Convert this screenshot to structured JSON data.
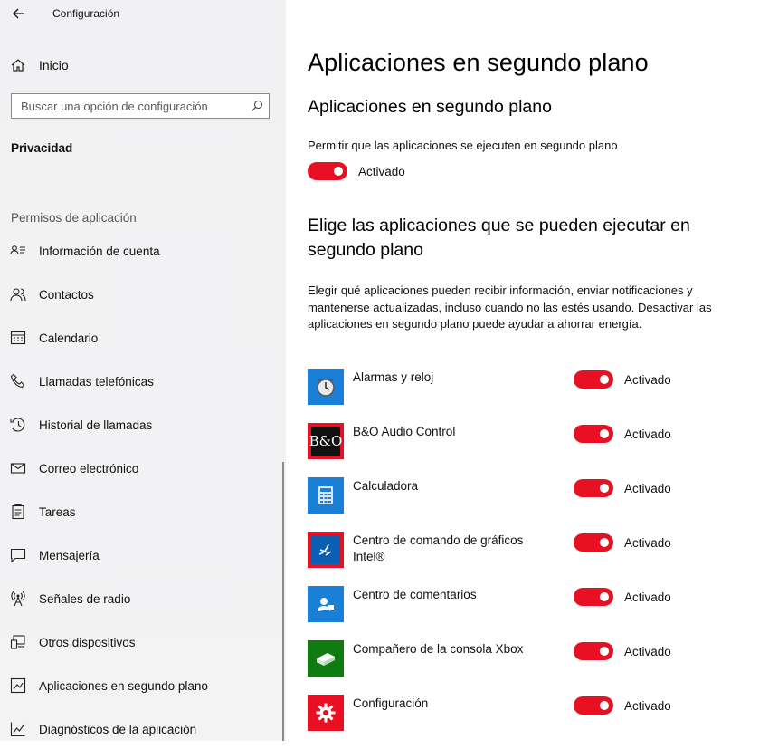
{
  "window": {
    "title": "Configuración"
  },
  "sidebar": {
    "home_label": "Inicio",
    "search_placeholder": "Buscar una opción de configuración",
    "section_label": "Privacidad",
    "group_label": "Permisos de aplicación",
    "items": [
      {
        "label": "Información de cuenta",
        "icon": "account-info-icon"
      },
      {
        "label": "Contactos",
        "icon": "contacts-icon"
      },
      {
        "label": "Calendario",
        "icon": "calendar-icon"
      },
      {
        "label": "Llamadas telefónicas",
        "icon": "phone-icon"
      },
      {
        "label": "Historial de llamadas",
        "icon": "call-history-icon"
      },
      {
        "label": "Correo electrónico",
        "icon": "mail-icon"
      },
      {
        "label": "Tareas",
        "icon": "tasks-icon"
      },
      {
        "label": "Mensajería",
        "icon": "messaging-icon"
      },
      {
        "label": "Señales de radio",
        "icon": "radio-icon"
      },
      {
        "label": "Otros dispositivos",
        "icon": "devices-icon"
      },
      {
        "label": "Aplicaciones en segundo plano",
        "icon": "background-apps-icon"
      },
      {
        "label": "Diagnósticos de la aplicación",
        "icon": "diagnostics-icon"
      }
    ]
  },
  "main": {
    "page_title": "Aplicaciones en segundo plano",
    "section_title": "Aplicaciones en segundo plano",
    "allow_label": "Permitir que las aplicaciones se ejecuten en segundo plano",
    "allow_state": "Activado",
    "choose_title": "Elige las aplicaciones que se pueden ejecutar en segundo plano",
    "description": "Elegir qué aplicaciones pueden recibir información, enviar notificaciones y mantenerse actualizadas, incluso cuando no las estés usando. Desactivar las aplicaciones en segundo plano puede ayudar a ahorrar energía.",
    "apps": [
      {
        "name": "Alarmas y reloj",
        "state": "Activado",
        "icon": "alarm-clock-icon",
        "color": "#1a7fd6"
      },
      {
        "name": "B&O Audio Control",
        "state": "Activado",
        "icon": "bo-audio-icon",
        "color": "#e81123"
      },
      {
        "name": "Calculadora",
        "state": "Activado",
        "icon": "calculator-icon",
        "color": "#1a7fd6"
      },
      {
        "name": "Centro de comando de gráficos Intel®",
        "state": "Activado",
        "icon": "intel-graphics-icon",
        "color": "#e81123"
      },
      {
        "name": "Centro de comentarios",
        "state": "Activado",
        "icon": "feedback-hub-icon",
        "color": "#1a7fd6"
      },
      {
        "name": "Compañero de la consola Xbox",
        "state": "Activado",
        "icon": "xbox-console-icon",
        "color": "#107c10"
      },
      {
        "name": "Configuración",
        "state": "Activado",
        "icon": "settings-gear-icon",
        "color": "#e81123"
      }
    ]
  },
  "colors": {
    "accent": "#e81123",
    "sidebar_bg": "#f2f2f2"
  }
}
